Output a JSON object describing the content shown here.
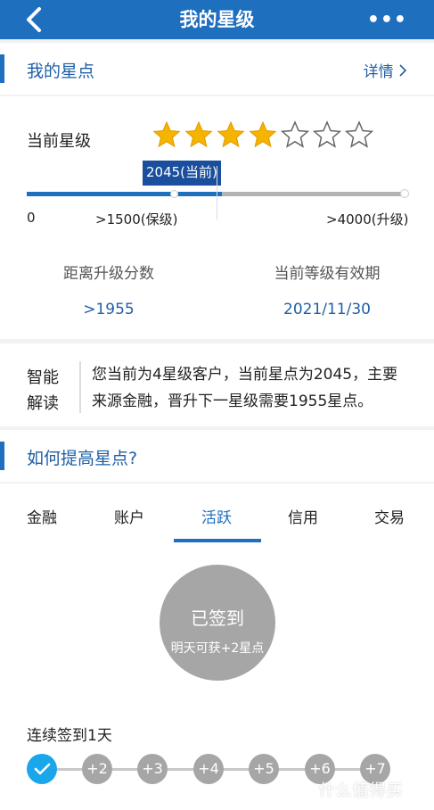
{
  "header": {
    "title": "我的星级",
    "back_icon": "chevron-left-icon",
    "more_icon": "more-dots-icon",
    "more_label": "•••"
  },
  "my_points": {
    "title": "我的星点",
    "detail_link": "详情"
  },
  "star_level": {
    "label": "当前星级",
    "stars_filled": 4,
    "stars_total": 7,
    "current_bubble": "2045(当前)",
    "progress": {
      "current": 2045,
      "keep": 1500,
      "upgrade": 4000
    },
    "ticks": {
      "zero": "0",
      "keep": ">1500(保级)",
      "upgrade": ">4000(升级)"
    }
  },
  "stats": {
    "gap_label": "距离升级分数",
    "gap_value": ">1955",
    "valid_label": "当前等级有效期",
    "valid_value": "2021/11/30"
  },
  "interpretation": {
    "title": "智能解读",
    "text": "您当前为4星级客户，当前星点为2045，主要来源金融，晋升下一星级需要1955星点。"
  },
  "improve": {
    "title": "如何提高星点?"
  },
  "tabs": [
    "金融",
    "账户",
    "活跃",
    "信用",
    "交易"
  ],
  "active_tab": 2,
  "checkin": {
    "status": "已签到",
    "hint": "明天可获+2星点"
  },
  "streak": {
    "text": "连续签到1天",
    "steps": [
      "+2",
      "+3",
      "+4",
      "+5",
      "+6",
      "+7"
    ]
  },
  "watermark": {
    "text": "什么值得买"
  },
  "colors": {
    "brand": "#1f6fbf",
    "star": "#f5b400",
    "done": "#1aa6ea",
    "grey": "#a6a6a6"
  }
}
